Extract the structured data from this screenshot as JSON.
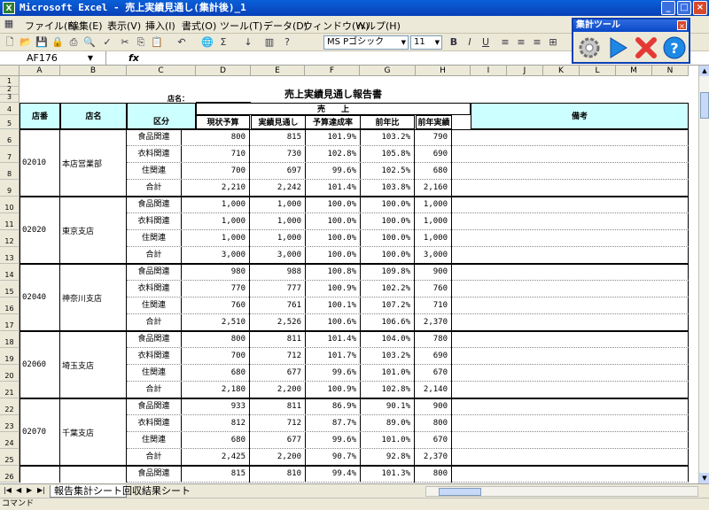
{
  "window": {
    "title": "Microsoft Excel - 売上実績見通し(集計後)_1"
  },
  "menu": [
    "ファイル(F)",
    "編集(E)",
    "表示(V)",
    "挿入(I)",
    "書式(O)",
    "ツール(T)",
    "データ(D)",
    "ウィンドウ(W)",
    "ヘルプ(H)"
  ],
  "toolbar": {
    "font_name": "MS Pゴシック",
    "font_size": "11"
  },
  "formula_bar": {
    "name_box": "AF176",
    "fx": "fx",
    "content": ""
  },
  "float_toolbar": {
    "title": "集計ツール"
  },
  "columns": [
    "A",
    "B",
    "C",
    "D",
    "E",
    "F",
    "G",
    "H",
    "I",
    "J",
    "K",
    "L",
    "M",
    "N"
  ],
  "rows": [
    "1",
    "2",
    "3",
    "4",
    "5",
    "6",
    "7",
    "8",
    "9",
    "10",
    "11",
    "12",
    "13",
    "14",
    "15",
    "16",
    "17",
    "18",
    "19",
    "20",
    "21",
    "22",
    "23",
    "24",
    "25",
    "26"
  ],
  "sheet": {
    "title": "売上実績見通し報告書",
    "store_name_label": "店名：",
    "headers": {
      "store_code": "店番",
      "store_name": "店名",
      "category": "区分",
      "sales_group": "売　　上",
      "budget": "現状予算",
      "forecast": "実績見通し",
      "achievement": "予算達成率",
      "yoy": "前年比",
      "prev_year": "前年実績",
      "remarks": "備考"
    },
    "stores": [
      {
        "code": "02010",
        "name": "本店営業部",
        "rows": [
          {
            "cat": "食品関連",
            "budget": "800",
            "forecast": "815",
            "rate": "101.9%",
            "yoy": "103.2%",
            "prev": "790"
          },
          {
            "cat": "衣料関連",
            "budget": "710",
            "forecast": "730",
            "rate": "102.8%",
            "yoy": "105.8%",
            "prev": "690"
          },
          {
            "cat": "住関連",
            "budget": "700",
            "forecast": "697",
            "rate": "99.6%",
            "yoy": "102.5%",
            "prev": "680"
          },
          {
            "cat": "合計",
            "budget": "2,210",
            "forecast": "2,242",
            "rate": "101.4%",
            "yoy": "103.8%",
            "prev": "2,160"
          }
        ]
      },
      {
        "code": "02020",
        "name": "東京支店",
        "rows": [
          {
            "cat": "食品関連",
            "budget": "1,000",
            "forecast": "1,000",
            "rate": "100.0%",
            "yoy": "100.0%",
            "prev": "1,000"
          },
          {
            "cat": "衣料関連",
            "budget": "1,000",
            "forecast": "1,000",
            "rate": "100.0%",
            "yoy": "100.0%",
            "prev": "1,000"
          },
          {
            "cat": "住関連",
            "budget": "1,000",
            "forecast": "1,000",
            "rate": "100.0%",
            "yoy": "100.0%",
            "prev": "1,000"
          },
          {
            "cat": "合計",
            "budget": "3,000",
            "forecast": "3,000",
            "rate": "100.0%",
            "yoy": "100.0%",
            "prev": "3,000"
          }
        ]
      },
      {
        "code": "02040",
        "name": "神奈川支店",
        "rows": [
          {
            "cat": "食品関連",
            "budget": "980",
            "forecast": "988",
            "rate": "100.8%",
            "yoy": "109.8%",
            "prev": "900"
          },
          {
            "cat": "衣料関連",
            "budget": "770",
            "forecast": "777",
            "rate": "100.9%",
            "yoy": "102.2%",
            "prev": "760"
          },
          {
            "cat": "住関連",
            "budget": "760",
            "forecast": "761",
            "rate": "100.1%",
            "yoy": "107.2%",
            "prev": "710"
          },
          {
            "cat": "合計",
            "budget": "2,510",
            "forecast": "2,526",
            "rate": "100.6%",
            "yoy": "106.6%",
            "prev": "2,370"
          }
        ]
      },
      {
        "code": "02060",
        "name": "埼玉支店",
        "rows": [
          {
            "cat": "食品関連",
            "budget": "800",
            "forecast": "811",
            "rate": "101.4%",
            "yoy": "104.0%",
            "prev": "780"
          },
          {
            "cat": "衣料関連",
            "budget": "700",
            "forecast": "712",
            "rate": "101.7%",
            "yoy": "103.2%",
            "prev": "690"
          },
          {
            "cat": "住関連",
            "budget": "680",
            "forecast": "677",
            "rate": "99.6%",
            "yoy": "101.0%",
            "prev": "670"
          },
          {
            "cat": "合計",
            "budget": "2,180",
            "forecast": "2,200",
            "rate": "100.9%",
            "yoy": "102.8%",
            "prev": "2,140"
          }
        ]
      },
      {
        "code": "02070",
        "name": "千葉支店",
        "rows": [
          {
            "cat": "食品関連",
            "budget": "933",
            "forecast": "811",
            "rate": "86.9%",
            "yoy": "90.1%",
            "prev": "900"
          },
          {
            "cat": "衣料関連",
            "budget": "812",
            "forecast": "712",
            "rate": "87.7%",
            "yoy": "89.0%",
            "prev": "800"
          },
          {
            "cat": "住関連",
            "budget": "680",
            "forecast": "677",
            "rate": "99.6%",
            "yoy": "101.0%",
            "prev": "670"
          },
          {
            "cat": "合計",
            "budget": "2,425",
            "forecast": "2,200",
            "rate": "90.7%",
            "yoy": "92.8%",
            "prev": "2,370"
          }
        ]
      },
      {
        "code": "",
        "name": "",
        "rows": [
          {
            "cat": "食品関連",
            "budget": "815",
            "forecast": "810",
            "rate": "99.4%",
            "yoy": "101.3%",
            "prev": "800"
          }
        ]
      }
    ]
  },
  "tabs": [
    "報告集計シート",
    "回収結果シート"
  ],
  "status": "コマンド"
}
